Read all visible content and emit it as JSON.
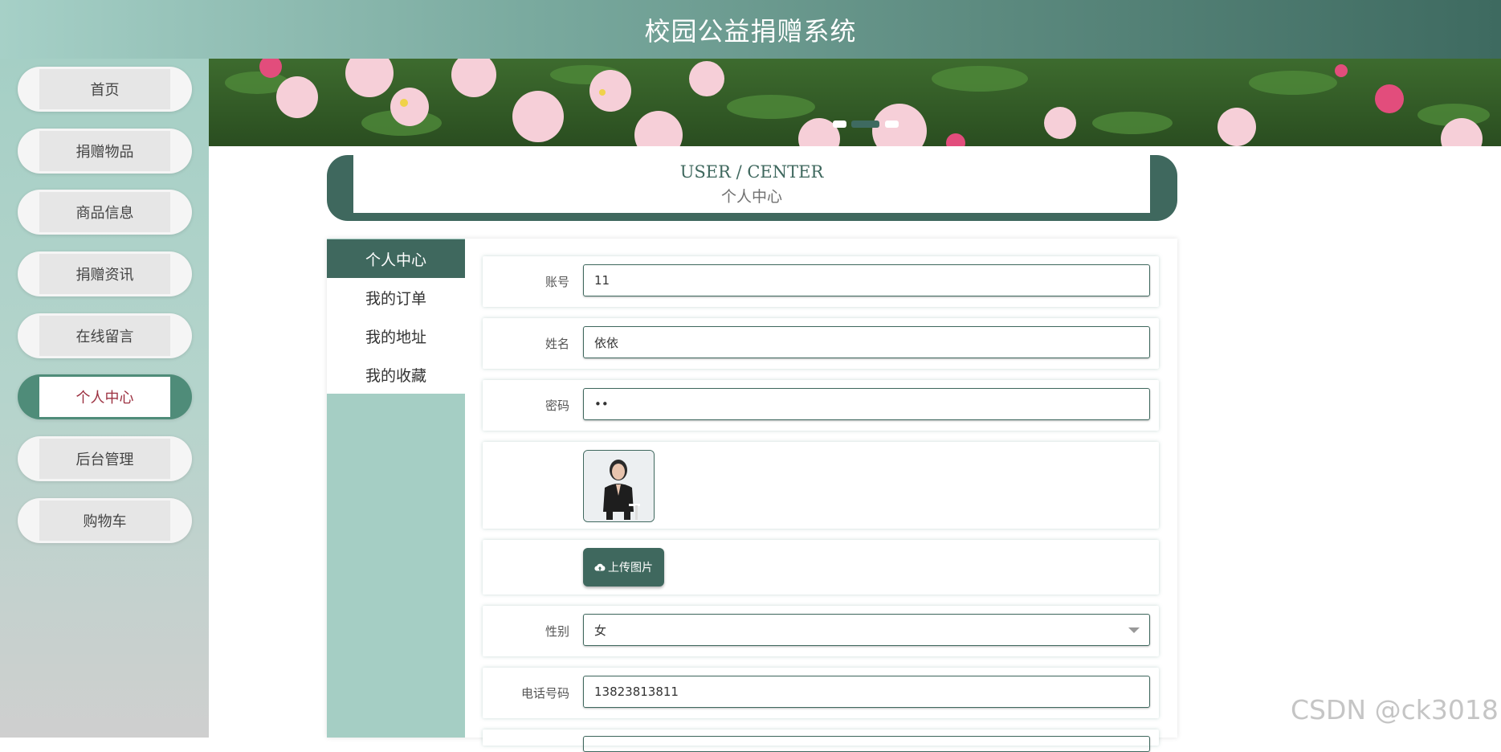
{
  "header": {
    "title": "校园公益捐赠系统"
  },
  "sidebar": {
    "items": [
      {
        "label": "首页",
        "active": false
      },
      {
        "label": "捐赠物品",
        "active": false
      },
      {
        "label": "商品信息",
        "active": false
      },
      {
        "label": "捐赠资讯",
        "active": false
      },
      {
        "label": "在线留言",
        "active": false
      },
      {
        "label": "个人中心",
        "active": true
      },
      {
        "label": "后台管理",
        "active": false
      },
      {
        "label": "购物车",
        "active": false
      }
    ]
  },
  "carousel": {
    "slide_count": 3,
    "active_index": 1
  },
  "user_center_banner": {
    "title_en": "USER / CENTER",
    "title_cn": "个人中心"
  },
  "sub_nav": {
    "items": [
      {
        "label": "个人中心",
        "active": true
      },
      {
        "label": "我的订单",
        "active": false
      },
      {
        "label": "我的地址",
        "active": false
      },
      {
        "label": "我的收藏",
        "active": false
      }
    ]
  },
  "form": {
    "account": {
      "label": "账号",
      "value": "11"
    },
    "name": {
      "label": "姓名",
      "value": "依依"
    },
    "password": {
      "label": "密码",
      "value": "••"
    },
    "upload": {
      "label": "上传图片",
      "icon": "cloud-upload-icon"
    },
    "gender": {
      "label": "性别",
      "value": "女"
    },
    "phone": {
      "label": "电话号码",
      "value": "13823813811"
    }
  },
  "watermark": "CSDN @ck3018",
  "colors": {
    "primary": "#3f685e",
    "accent_active": "#4f8c79",
    "sidebar_bg": "#a5cec4"
  }
}
